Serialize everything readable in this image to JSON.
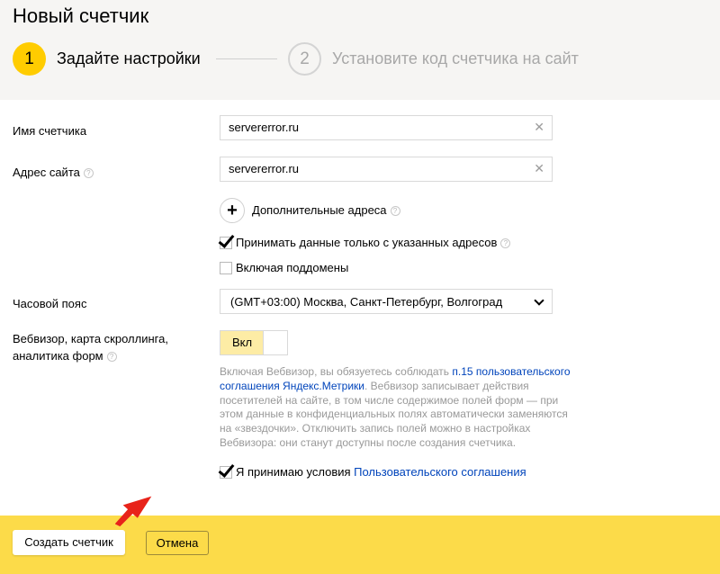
{
  "header": {
    "title": "Новый счетчик",
    "steps": [
      {
        "number": "1",
        "label": "Задайте настройки"
      },
      {
        "number": "2",
        "label": "Установите код счетчика на сайт"
      }
    ]
  },
  "form": {
    "name_label": "Имя счетчика",
    "name_value": "servererror.ru",
    "address_label": "Адрес сайта",
    "address_value": "servererror.ru",
    "additional_addresses": "Дополнительные адреса",
    "only_specified": "Принимать данные только с указанных адресов",
    "include_subdomains": "Включая поддомены",
    "timezone_label": "Часовой пояс",
    "timezone_value": "(GMT+03:00) Москва, Санкт-Петербург, Волгоград",
    "webvisor_label_1": "Вебвизор, карта скроллинга,",
    "webvisor_label_2": "аналитика форм",
    "webvisor_toggle": "Вкл",
    "note_before_link": "Включая Вебвизор, вы обязуетесь соблюдать ",
    "note_link": "п.15 пользовательского соглашения Яндекс.Метрики",
    "note_after_link": ". Вебвизор записывает действия посетителей на сайте, в том числе содержимое полей форм — при этом данные в конфиденциальных полях автоматически заменяются на «звездочки». Отключить запись полей можно в настройках Вебвизора: они станут доступны после создания счетчика.",
    "accept_text": "Я принимаю условия ",
    "accept_link": "Пользовательского соглашения",
    "help_glyph": "?",
    "clear_glyph": "✕",
    "plus_glyph": "+"
  },
  "footer": {
    "create_button": "Создать счетчик",
    "cancel_button": "Отмена"
  },
  "colors": {
    "accent": "#ffcc00",
    "footer_bg": "#fcdb49",
    "link": "#0044bb",
    "arrow": "#e8231a"
  }
}
